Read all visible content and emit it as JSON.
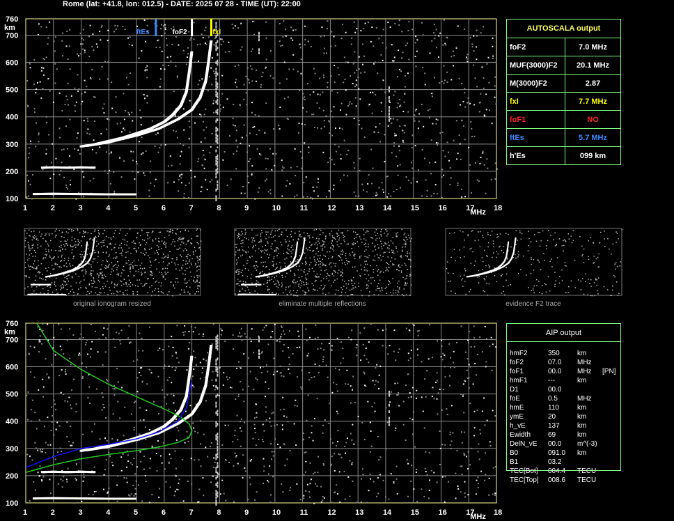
{
  "header": "Rome (lat: +41.8, lon: 012.5) - DATE: 2025 07 28 - TIME (UT): 22:00",
  "colors": {
    "grid": "#8a8a8a",
    "panel_border": "#ffff99",
    "table_border": "#7fff7f",
    "fxl": "#ffff00",
    "fof1": "#ff2020",
    "ftes": "#3a8aff",
    "green": "#22c922",
    "blue": "#1010ff"
  },
  "main_chart": {
    "markers": [
      {
        "label": "ftEs",
        "freq": 5.7,
        "color": "#3a8aff"
      },
      {
        "label": "foF2",
        "freq": 7.0,
        "color": "#ffffff"
      },
      {
        "label": "fxI",
        "freq": 7.7,
        "color": "#ffff00"
      }
    ]
  },
  "chart_data": [
    {
      "type": "scatter",
      "name": "main ionogram",
      "x_unit": "MHz",
      "y_unit": "km",
      "xlim": [
        1,
        18
      ],
      "ylim": [
        100,
        760
      ],
      "x_ticks": [
        1,
        2,
        3,
        4,
        5,
        6,
        7,
        8,
        9,
        10,
        11,
        12,
        13,
        14,
        15,
        16,
        17,
        18
      ],
      "y_ticks": [
        100,
        200,
        300,
        400,
        500,
        600,
        700,
        760
      ],
      "grid": true,
      "series": [
        {
          "x": [
            3.0,
            3.5,
            4.0,
            4.5,
            5.0,
            5.5,
            6.0,
            6.3,
            6.6,
            6.8,
            6.9,
            7.0
          ],
          "y": [
            290,
            298,
            310,
            322,
            338,
            355,
            380,
            405,
            440,
            490,
            560,
            640
          ]
        },
        {
          "x": [
            3.2,
            4.0,
            5.0,
            5.8,
            6.5,
            7.0,
            7.3,
            7.5,
            7.6,
            7.7
          ],
          "y": [
            292,
            305,
            330,
            355,
            390,
            425,
            470,
            530,
            600,
            680
          ]
        },
        {
          "x": [
            1.6,
            2.0,
            2.5,
            3.0,
            3.5
          ],
          "y": [
            212,
            213,
            212,
            213,
            212
          ]
        },
        {
          "x": [
            1.3,
            2.0,
            3.0,
            4.0,
            5.0
          ],
          "y": [
            115,
            116,
            115,
            114,
            114
          ]
        }
      ]
    },
    {
      "type": "line",
      "name": "AIP profile",
      "x_unit": "MHz",
      "y_unit": "km",
      "xlim": [
        1,
        18
      ],
      "ylim": [
        100,
        760
      ],
      "x_ticks": [
        1,
        2,
        3,
        4,
        5,
        6,
        7,
        8,
        9,
        10,
        11,
        12,
        13,
        14,
        15,
        16,
        17,
        18
      ],
      "y_ticks": [
        100,
        200,
        300,
        400,
        500,
        600,
        700,
        760
      ],
      "grid": true,
      "series": [
        {
          "x": [
            1.0,
            2.0,
            3.0,
            4.0,
            5.0,
            5.8,
            6.5,
            6.9,
            7.0,
            6.9,
            6.6,
            6.0,
            5.0,
            4.0,
            3.0,
            2.0,
            1.4
          ],
          "y": [
            212,
            240,
            262,
            278,
            292,
            305,
            322,
            340,
            365,
            390,
            415,
            445,
            490,
            535,
            590,
            660,
            760
          ]
        },
        {
          "x": [
            1.0,
            2.0,
            3.0,
            4.0,
            5.0,
            5.8,
            6.5,
            6.8,
            7.0
          ],
          "y": [
            230,
            270,
            300,
            315,
            335,
            360,
            400,
            450,
            550
          ]
        }
      ]
    }
  ],
  "autoscala": {
    "title": "AUTOSCALA output",
    "rows": [
      {
        "label": "foF2",
        "value": "7.0 MHz",
        "color": "#ffffff"
      },
      {
        "label": "MUF(3000)F2",
        "value": "20.1 MHz",
        "color": "#ffffff"
      },
      {
        "label": "M(3000)F2",
        "value": "2.87",
        "color": "#ffffff"
      },
      {
        "label": "fxI",
        "value": "7.7 MHz",
        "color": "#ffff00"
      },
      {
        "label": "foF1",
        "value": "NO",
        "color": "#ff2020"
      },
      {
        "label": "ftEs",
        "value": "5.7 MHz",
        "color": "#3a8aff"
      },
      {
        "label": "h'Es",
        "value": "099    km",
        "color": "#ffffff"
      }
    ]
  },
  "thumbs": [
    {
      "caption": "original ionogram resized"
    },
    {
      "caption": "eliminate multiple reflections"
    },
    {
      "caption": "evidence F2 trace"
    }
  ],
  "aip": {
    "title": "AIP output",
    "rows": [
      [
        "hmF2",
        "350",
        "km",
        ""
      ],
      [
        "foF2",
        "07.0",
        "MHz",
        ""
      ],
      [
        "foF1",
        "00.0",
        "MHz",
        "[PN]"
      ],
      [
        "hmF1",
        "---",
        "km",
        ""
      ],
      [
        "D1",
        "00.0",
        "",
        ""
      ],
      [
        "foE",
        "0.5",
        "MHz",
        ""
      ],
      [
        "hmE",
        "110",
        "km",
        ""
      ],
      [
        "ymE",
        "20",
        "km",
        ""
      ],
      [
        "h_vE",
        "137",
        "km",
        ""
      ],
      [
        "Ewidth",
        "69",
        "km",
        ""
      ],
      [
        "DelN_vE",
        "00.0",
        "m^(-3)",
        ""
      ],
      [
        "B0",
        "091.0",
        "km",
        ""
      ],
      [
        "B1",
        "03.2",
        "",
        ""
      ],
      [
        "TEC[Bot]",
        "004.4",
        "TECU",
        ""
      ],
      [
        "TEC[Top]",
        "008.6",
        "TECU",
        ""
      ]
    ]
  },
  "axis": {
    "x_unit": "MHz",
    "y_unit": "km"
  }
}
